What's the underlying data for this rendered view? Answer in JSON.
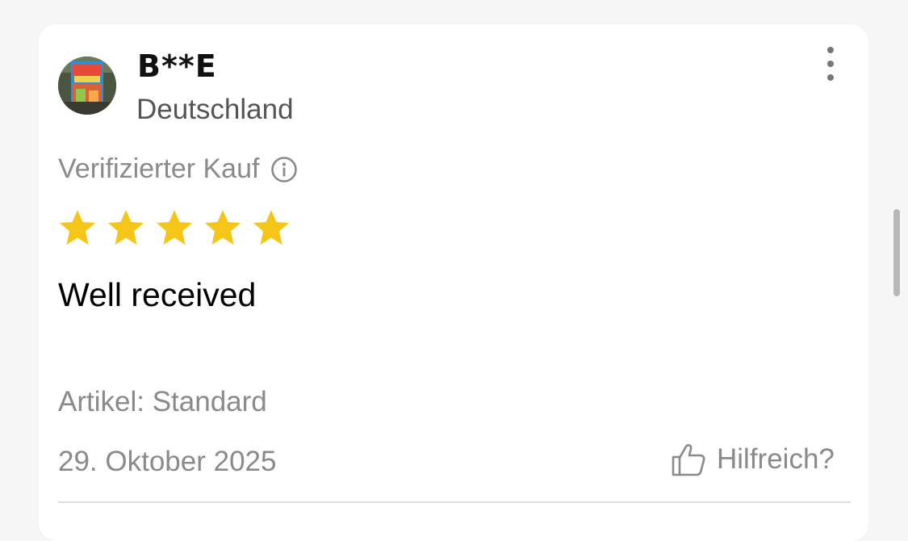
{
  "review": {
    "username": "B**E",
    "country": "Deutschland",
    "verified_label": "Verifizierter Kauf",
    "rating": 5,
    "rating_max": 5,
    "title": "Well received",
    "variant": "Artikel: Standard",
    "date": "29. Oktober 2025",
    "helpful_label": "Hilfreich?"
  },
  "icons": {
    "info": "info-icon",
    "more": "more-vertical-icon",
    "thumb": "thumbs-up-icon",
    "star": "star-icon"
  },
  "colors": {
    "star": "#F5C518",
    "muted_text": "#8A8A8A",
    "primary_text": "#000000"
  }
}
